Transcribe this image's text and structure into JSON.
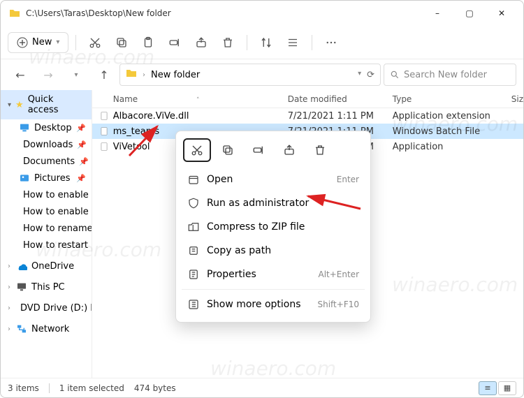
{
  "title_path": "C:\\Users\\Taras\\Desktop\\New folder",
  "window": {
    "min": "–",
    "max": "▢",
    "close": "✕"
  },
  "toolbar": {
    "new": "New",
    "icons": [
      "cut",
      "copy",
      "paste",
      "rename",
      "share",
      "delete"
    ]
  },
  "nav": {
    "back": "←",
    "forward": "→",
    "up": "↑",
    "crumb": "New folder",
    "refresh": "⟳",
    "search_placeholder": "Search New folder"
  },
  "sidebar": {
    "quick_access": "Quick access",
    "items": [
      {
        "label": "Desktop",
        "icon": "desktop",
        "pinned": true
      },
      {
        "label": "Downloads",
        "icon": "downloads",
        "pinned": true
      },
      {
        "label": "Documents",
        "icon": "documents",
        "pinned": true
      },
      {
        "label": "Pictures",
        "icon": "pictures",
        "pinned": true
      },
      {
        "label": "How to enable Nig…",
        "icon": "folder",
        "pinned": false
      },
      {
        "label": "How to enable or d…",
        "icon": "folder",
        "pinned": false
      },
      {
        "label": "How to rename driv…",
        "icon": "folder",
        "pinned": false
      },
      {
        "label": "How to restart File E…",
        "icon": "folder",
        "pinned": false
      }
    ],
    "roots": [
      {
        "label": "OneDrive",
        "icon": "onedrive"
      },
      {
        "label": "This PC",
        "icon": "thispc"
      },
      {
        "label": "DVD Drive (D:) ESD-IS…",
        "icon": "dvd"
      },
      {
        "label": "Network",
        "icon": "network"
      }
    ]
  },
  "columns": {
    "name": "Name",
    "date": "Date modified",
    "type": "Type",
    "size": "Siz"
  },
  "rows": [
    {
      "name": "Albacore.ViVe.dll",
      "date": "7/21/2021 1:11 PM",
      "type": "Application extension",
      "selected": false
    },
    {
      "name": "ms_teams",
      "date": "7/21/2021 1:11 PM",
      "type": "Windows Batch File",
      "selected": true
    },
    {
      "name": "ViVetool",
      "date": "7/21/2021 1:11 PM",
      "type": "Application",
      "selected": false
    }
  ],
  "context_menu": {
    "top_icons": [
      "cut",
      "copy",
      "rename",
      "share",
      "delete"
    ],
    "items": [
      {
        "label": "Open",
        "hint": "Enter",
        "icon": "open"
      },
      {
        "label": "Run as administrator",
        "hint": "",
        "icon": "shield"
      },
      {
        "label": "Compress to ZIP file",
        "hint": "",
        "icon": "zip"
      },
      {
        "label": "Copy as path",
        "hint": "",
        "icon": "path"
      },
      {
        "label": "Properties",
        "hint": "Alt+Enter",
        "icon": "props"
      }
    ],
    "more": {
      "label": "Show more options",
      "hint": "Shift+F10"
    }
  },
  "status": {
    "count": "3 items",
    "selection": "1 item selected",
    "size": "474 bytes"
  },
  "watermark": "winaero.com"
}
